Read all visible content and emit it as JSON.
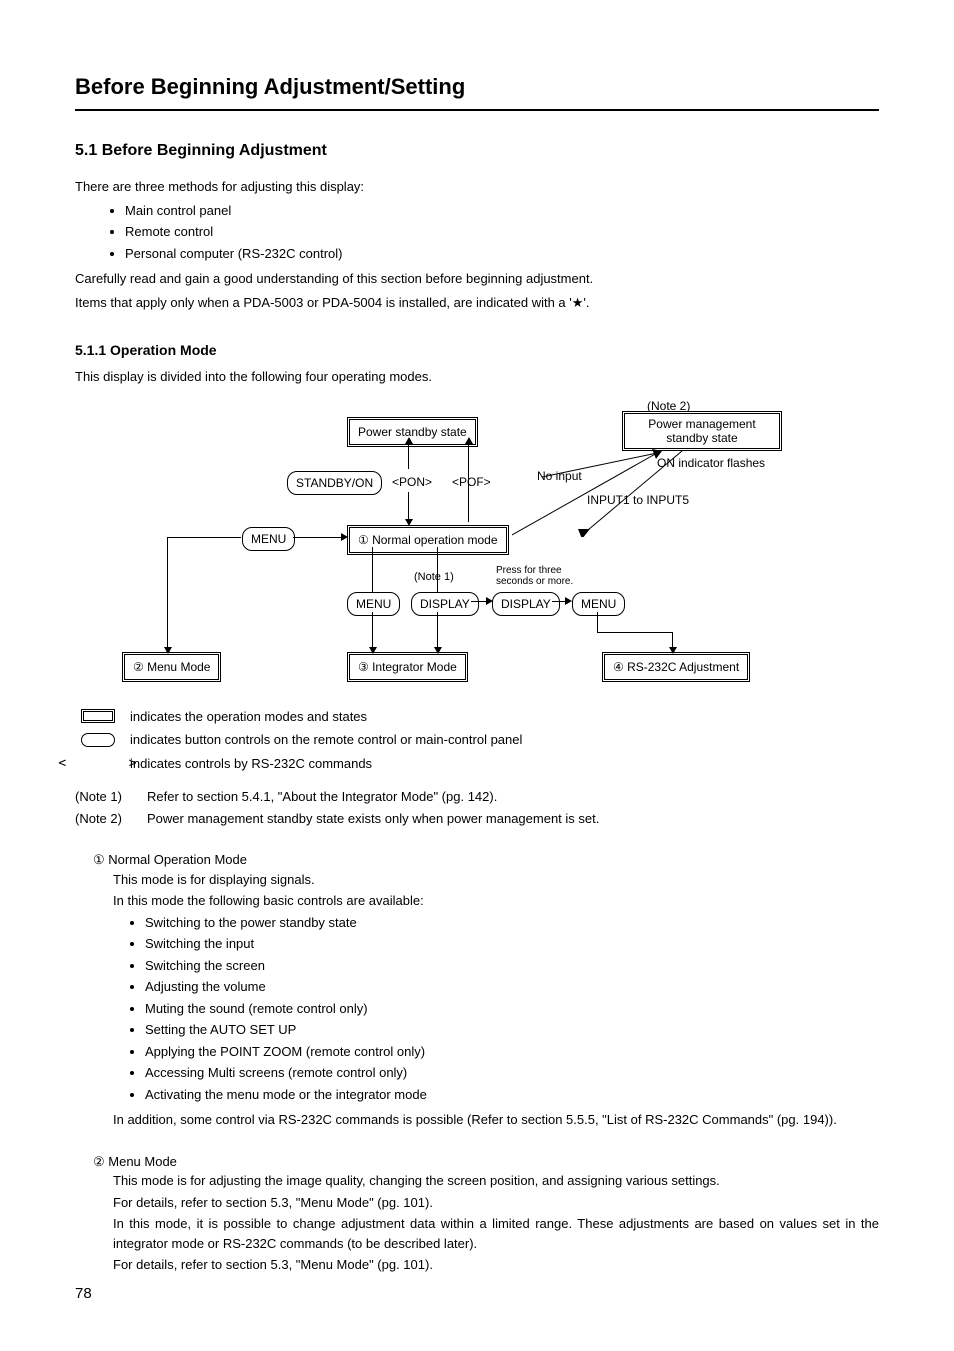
{
  "chapter_title": "Before Beginning Adjustment/Setting",
  "section_title": "5.1 Before Beginning Adjustment",
  "intro_para": "There are three methods for adjusting this display:",
  "methods": [
    "Main control panel",
    "Remote control",
    "Personal computer (RS-232C control)"
  ],
  "intro_after1": "Carefully read and gain a good understanding of this section before beginning adjustment.",
  "intro_after2": "Items that apply only when a PDA-5003 or PDA-5004 is installed, are indicated with a '★'.",
  "subsection_title": "5.1.1 Operation Mode",
  "subsection_intro": "This display is divided into the following four operating modes.",
  "diagram": {
    "note2_top": "(Note 2)",
    "power_standby": "Power standby state",
    "power_mgmt": "Power management standby state",
    "on_indicator": "ON indicator flashes",
    "standby_on": "STANDBY/ON",
    "pon": "<PON>",
    "pof": "<POF>",
    "no_input": "No input",
    "inputs": "INPUT1 to INPUT5",
    "menu1": "MENU",
    "normal_op": "① Normal operation mode",
    "menu2": "MENU",
    "display1": "DISPLAY",
    "display2": "DISPLAY",
    "menu3": "MENU",
    "note1": "(Note 1)",
    "press3": "Press for three seconds or more.",
    "menu_mode": "② Menu Mode",
    "integrator_mode": "③ Integrator Mode",
    "rs232c_adj": "④ RS-232C Adjustment"
  },
  "legend": {
    "double_box": "indicates the operation modes and states",
    "round_box": "indicates button controls on the remote control or main-control panel",
    "angle": "<        >",
    "angle_text": "indicates controls by RS-232C commands"
  },
  "notes": {
    "note1_label": "(Note 1)",
    "note1_text": "Refer to section 5.4.1, \"About the Integrator Mode\" (pg. 142).",
    "note2_label": "(Note 2)",
    "note2_text": "Power management standby state exists only when power management is set."
  },
  "mode1": {
    "head": "① Normal Operation Mode",
    "p1": "This mode is for displaying signals.",
    "p2": "In this mode the following basic controls are available:",
    "bullets": [
      "Switching to the power standby state",
      "Switching the input",
      "Switching the screen",
      "Adjusting the volume",
      "Muting the sound (remote control only)",
      "Setting the AUTO SET UP",
      "Applying the POINT ZOOM (remote control only)",
      "Accessing Multi screens (remote control only)",
      "Activating the menu mode or the integrator mode"
    ],
    "p3": "In addition, some control via RS-232C commands is possible (Refer to section 5.5.5, \"List of RS-232C Commands\" (pg. 194))."
  },
  "mode2": {
    "head": "② Menu Mode",
    "p1": "This mode is for adjusting the image quality, changing the screen position, and assigning various settings.",
    "p2": "For details, refer to section 5.3, \"Menu Mode\" (pg. 101).",
    "p3": "In this mode, it is possible to change adjustment data within a limited range. These adjustments are based on values set in the integrator mode or RS-232C commands (to be described later).",
    "p4": "For details, refer to section 5.3, \"Menu Mode\" (pg. 101)."
  },
  "page_number": "78"
}
